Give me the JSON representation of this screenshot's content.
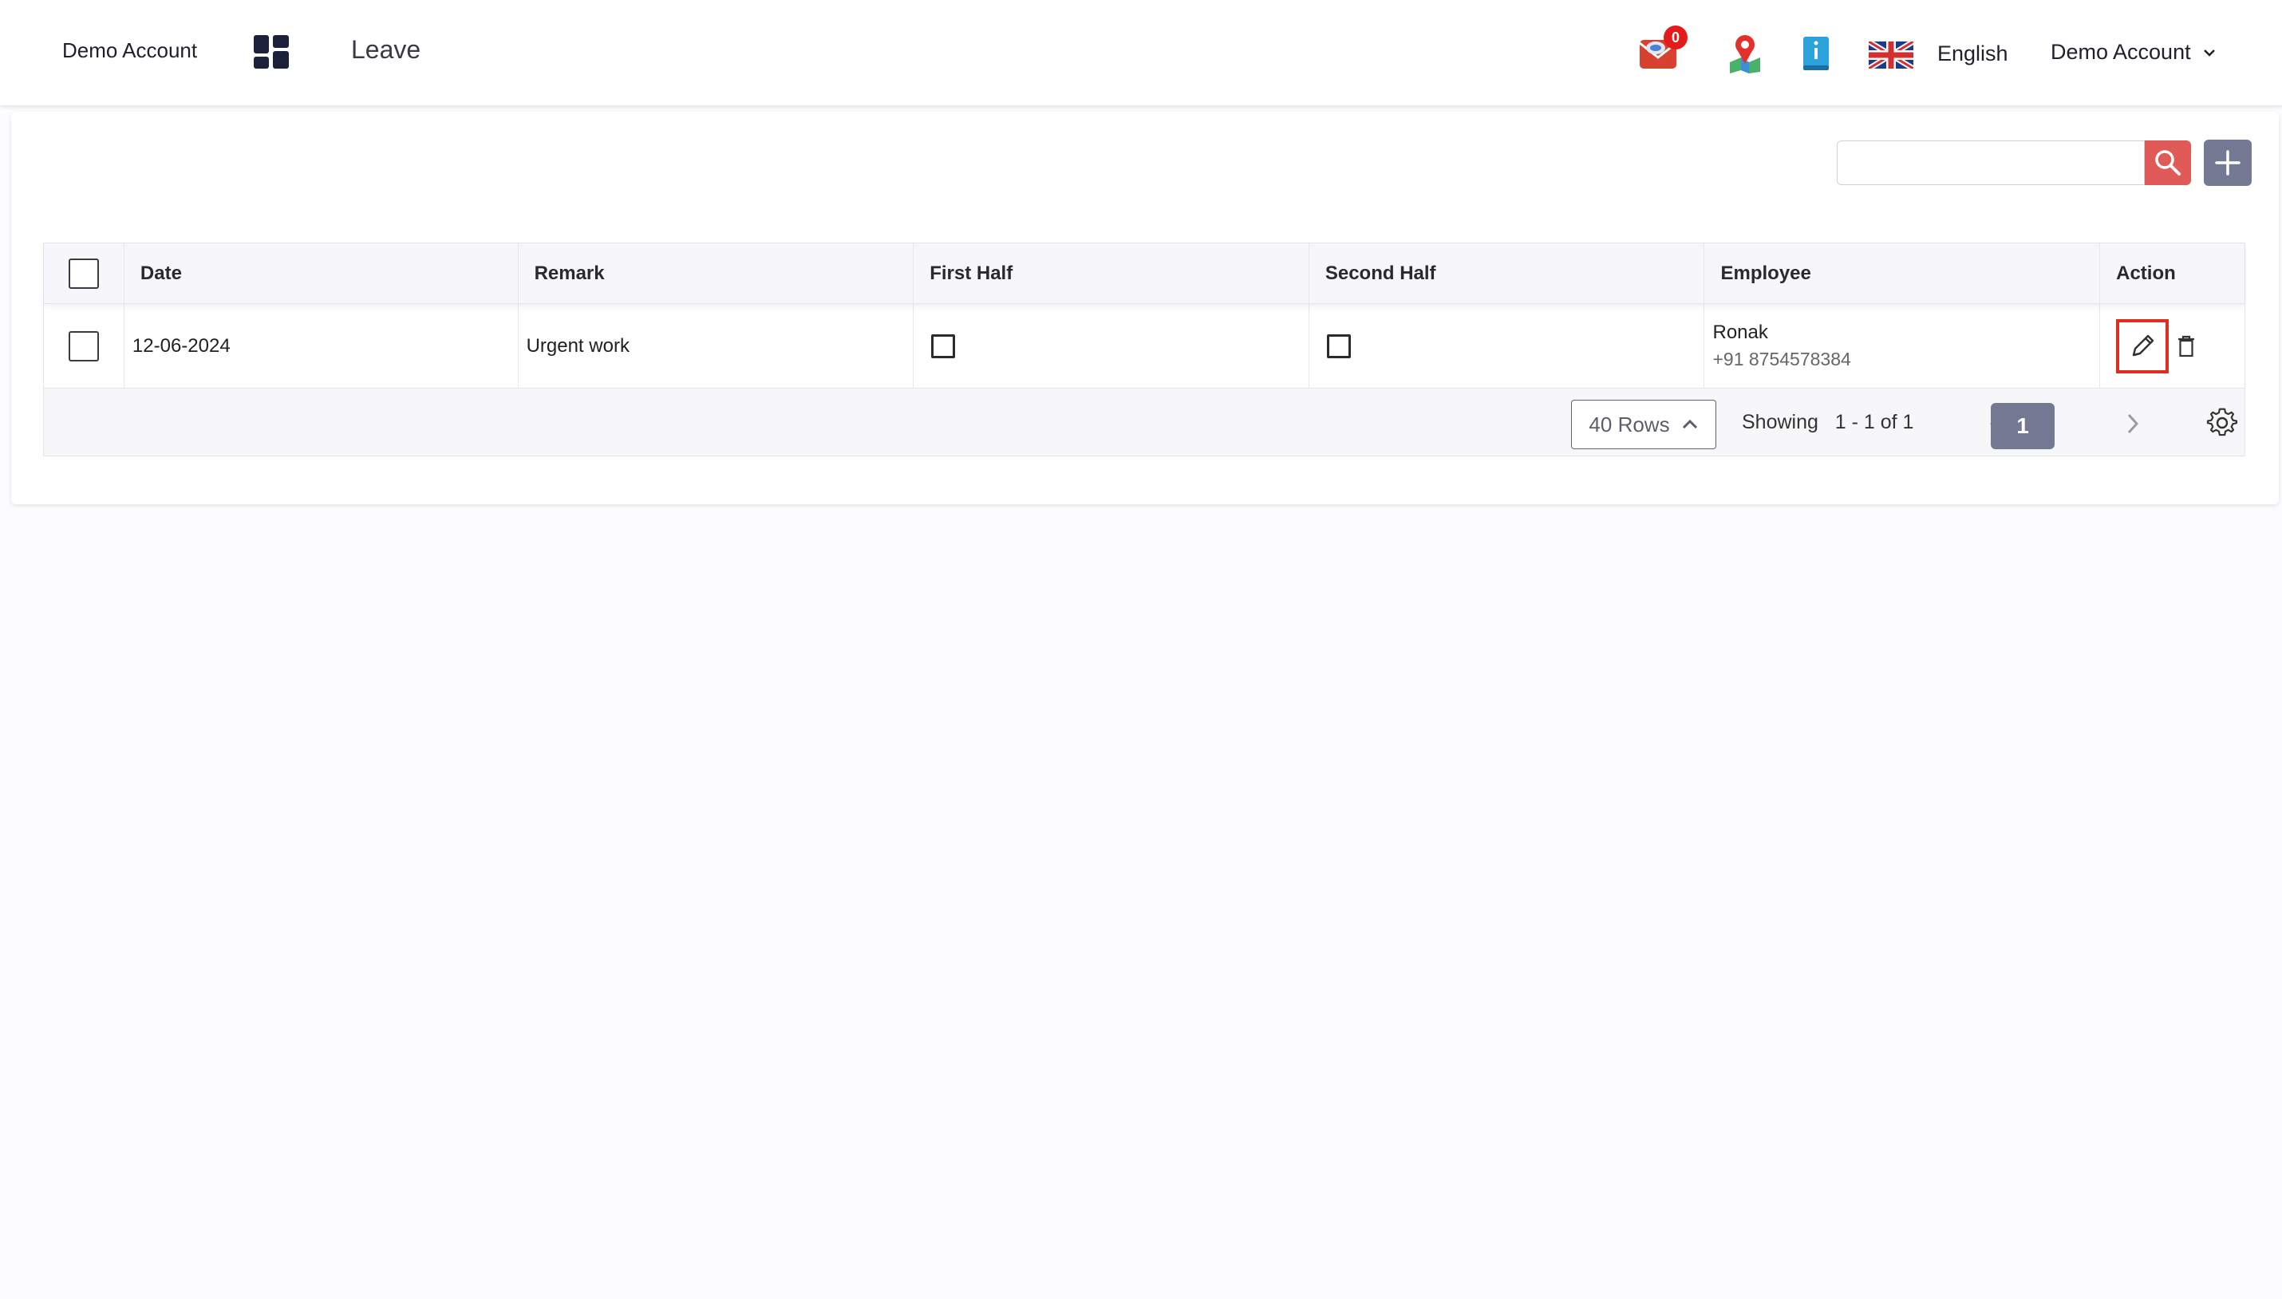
{
  "header": {
    "account_name": "Demo Account",
    "page_title": "Leave",
    "mail_badge_count": "0",
    "language": "English",
    "account_menu_label": "Demo Account",
    "icons": [
      "apps-grid-icon",
      "mail-icon",
      "map-pin-icon",
      "info-book-icon",
      "uk-flag-icon",
      "chevron-down-icon"
    ]
  },
  "toolbar": {
    "search_value": "",
    "search_placeholder": "",
    "icons": [
      "search-icon",
      "plus-icon"
    ]
  },
  "table": {
    "columns": [
      "Date",
      "Remark",
      "First Half",
      "Second Half",
      "Employee",
      "Action"
    ],
    "rows": [
      {
        "date": "12-06-2024",
        "remark": "Urgent work",
        "first_half": false,
        "second_half": false,
        "employee_name": "Ronak",
        "employee_phone": "+91 8754578384"
      }
    ]
  },
  "pagination": {
    "rows_per_page": "40 Rows",
    "showing": "Showing   1 - 1 of 1",
    "current_page": "1"
  },
  "colors": {
    "search_button": "#e05a57",
    "primary_button": "#737993",
    "highlight_border": "#e02d22",
    "badge": "#e21b1b"
  }
}
